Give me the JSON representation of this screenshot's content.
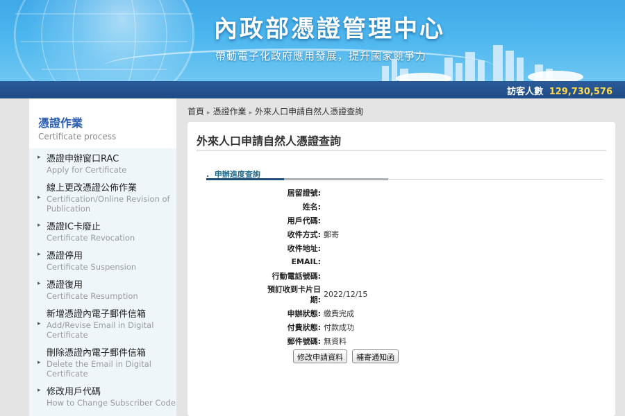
{
  "header": {
    "title": "內政部憑證管理中心",
    "slogan": "帶動電子化政府應用發展，提升國家競爭力"
  },
  "visitor": {
    "label": "訪客人數",
    "count": "129,730,576"
  },
  "sidebar": {
    "title": "憑證作業",
    "subtitle": "Certificate process",
    "items": [
      {
        "zh": "憑證申辦窗口RAC",
        "en": "Apply for Certificate"
      },
      {
        "zh": "線上更改憑證公佈作業",
        "en": "Certification/Online Revision of Publication"
      },
      {
        "zh": "憑證IC卡廢止",
        "en": "Certificate Revocation"
      },
      {
        "zh": "憑證停用",
        "en": "Certificate Suspension"
      },
      {
        "zh": "憑證復用",
        "en": "Certificate Resumption"
      },
      {
        "zh": "新增憑證內電子郵件信箱",
        "en": "Add/Revise Email in Digital Certificate"
      },
      {
        "zh": "刪除憑證內電子郵件信箱",
        "en": "Delete the Email in Digital Certificate"
      },
      {
        "zh": "修改用戶代碼",
        "en": "How to Change Subscriber Code"
      }
    ]
  },
  "breadcrumb": [
    "首頁",
    "憑證作業",
    "外來人口申請自然人憑證查詢"
  ],
  "page": {
    "title": "外來人口申請自然人憑證查詢",
    "section_tab": "申辦進度查詢"
  },
  "fields": [
    {
      "label": "居留證號:",
      "value": ""
    },
    {
      "label": "姓名:",
      "value": ""
    },
    {
      "label": "用戶代碼:",
      "value": ""
    },
    {
      "label": "收件方式:",
      "value": "郵寄"
    },
    {
      "label": "收件地址:",
      "value": ""
    },
    {
      "label": "EMAIL:",
      "value": ""
    },
    {
      "label": "行動電話號碼:",
      "value": ""
    },
    {
      "label": "預訂收到卡片日期:",
      "value": "2022/12/15"
    },
    {
      "label": "申辦狀態:",
      "value": "繳費完成"
    },
    {
      "label": "付費狀態:",
      "value": "付款成功"
    },
    {
      "label": "郵件號碼:",
      "value": "無資料"
    }
  ],
  "actions": {
    "modify_label": "修改申請資料",
    "notice_label": "補寄通知函"
  }
}
